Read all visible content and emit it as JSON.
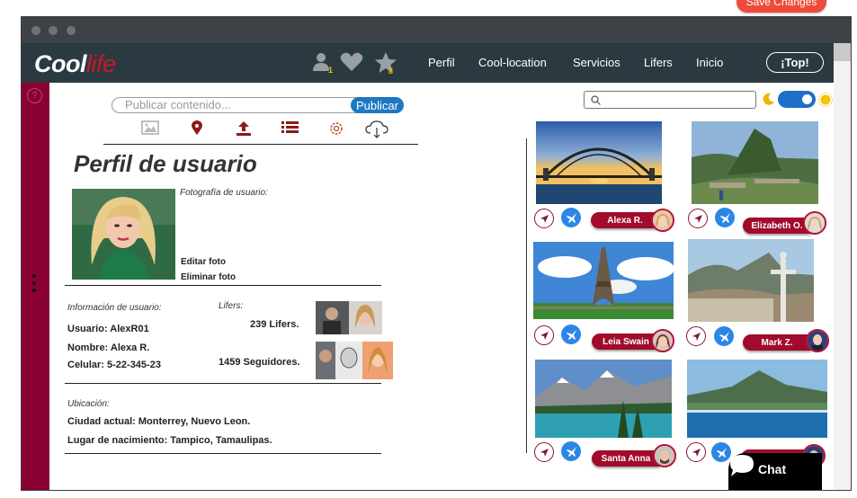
{
  "save_changes": "Save Changes",
  "nav": {
    "logo_a": "Cool",
    "logo_b": "life",
    "badge_users": "1",
    "badge_stars": "8",
    "links": [
      "Perfil",
      "Cool-location",
      "Servicios",
      "Lifers",
      "Inicio"
    ],
    "top_button": "¡Top!"
  },
  "sidebar": {
    "help": "?"
  },
  "post": {
    "placeholder": "Publicar contenido...",
    "button": "Publicar"
  },
  "profile": {
    "title": "Perfil de usuario",
    "photo_label": "Fotografía de usuario:",
    "edit_photo": "Editar foto",
    "delete_photo": "Eliminar foto",
    "info_label": "Información de usuario:",
    "username": "Usuario: AlexR01",
    "name": "Nombre: Alexa R.",
    "phone": "Celular: 5-22-345-23",
    "lifers_label": "Lifers:",
    "lifers_count": "239 Lifers.",
    "followers_count": "1459 Seguidores.",
    "location_label": "Ubicación:",
    "current_city": "Ciudad actual: Monterrey, Nuevo Leon.",
    "birthplace": "Lugar de nacimiento: Tampico, Tamaulipas."
  },
  "cards": [
    {
      "name": "Alexa R."
    },
    {
      "name": "Elizabeth O."
    },
    {
      "name": "Leia Swain"
    },
    {
      "name": "Mark Z."
    },
    {
      "name": "Santa Anna"
    },
    {
      "name": ""
    }
  ],
  "chat": {
    "label": "Chat"
  },
  "colors": {
    "navbar": "#2b3a40",
    "sidebar": "#8a0033",
    "accent_blue": "#1e78c2",
    "pill": "#a10b2c"
  }
}
